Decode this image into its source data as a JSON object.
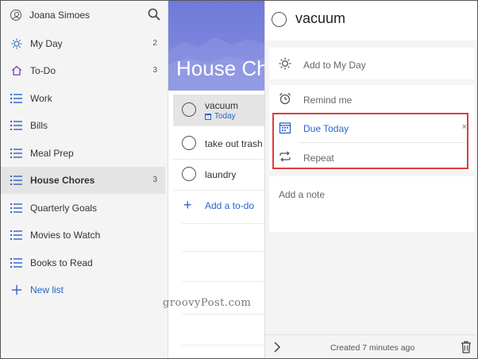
{
  "user": {
    "name": "Joana Simoes"
  },
  "icons": {
    "user": "person-icon",
    "search": "search-icon",
    "sun": "sun-icon",
    "home": "home-icon",
    "list": "list-icon",
    "plus": "plus-icon",
    "calendar": "calendar-icon",
    "alarm": "alarm-clock-icon",
    "repeat": "repeat-icon",
    "chevron": "chevron-right-icon",
    "trash": "trash-icon",
    "close": "close-icon"
  },
  "colors": {
    "accent": "#2b63c9",
    "banner": "#7983dc",
    "highlight": "#e0393e"
  },
  "sidebar": {
    "items": [
      {
        "label": "My Day",
        "count": "2",
        "icon": "sun-icon"
      },
      {
        "label": "To-Do",
        "count": "3",
        "icon": "home-icon"
      },
      {
        "label": "Work",
        "count": "",
        "icon": "list-icon"
      },
      {
        "label": "Bills",
        "count": "",
        "icon": "list-icon"
      },
      {
        "label": "Meal Prep",
        "count": "",
        "icon": "list-icon"
      },
      {
        "label": "House Chores",
        "count": "3",
        "icon": "list-icon",
        "active": true
      },
      {
        "label": "Quarterly Goals",
        "count": "",
        "icon": "list-icon"
      },
      {
        "label": "Movies to Watch",
        "count": "",
        "icon": "list-icon"
      },
      {
        "label": "Books to Read",
        "count": "",
        "icon": "list-icon"
      }
    ],
    "new_list": "New list"
  },
  "list": {
    "title": "House Chores",
    "tasks": [
      {
        "title": "vacuum",
        "due": "Today"
      },
      {
        "title": "take out trash",
        "due": ""
      },
      {
        "title": "laundry",
        "due": ""
      }
    ],
    "add_label": "Add a to-do"
  },
  "detail": {
    "title": "vacuum",
    "add_my_day": "Add to My Day",
    "remind_me": "Remind me",
    "due": "Due Today",
    "due_clear": "×",
    "repeat": "Repeat",
    "note_placeholder": "Add a note",
    "created": "Created 7 minutes ago"
  },
  "watermark": "groovyPost.com"
}
